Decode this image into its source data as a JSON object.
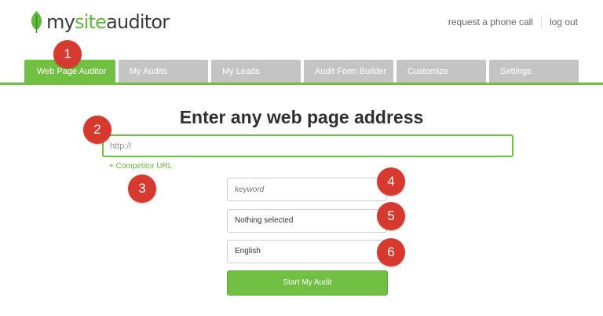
{
  "header": {
    "logo_prefix": "my",
    "logo_site": "site",
    "logo_suffix": "auditor",
    "links": [
      "request a phone call",
      "log out"
    ]
  },
  "tabs": [
    {
      "label": "Web Page Auditor",
      "active": true
    },
    {
      "label": "My Audits",
      "active": false
    },
    {
      "label": "My Leads",
      "active": false
    },
    {
      "label": "Audit Form Builder",
      "active": false
    },
    {
      "label": "Customize",
      "active": false
    },
    {
      "label": "Settings",
      "active": false
    }
  ],
  "main": {
    "heading": "Enter any web page address",
    "url_placeholder": "http://",
    "competitor_link": "+ Competitor URL",
    "keyword_placeholder": "keyword",
    "select_location_value": "Nothing selected",
    "select_language_value": "English",
    "submit_label": "Start My Audit"
  },
  "badges": [
    "1",
    "2",
    "3",
    "4",
    "5",
    "6"
  ],
  "colors": {
    "brand_green": "#72c043",
    "tab_inactive": "#c4c4c4",
    "badge_red": "#d63a2f"
  }
}
